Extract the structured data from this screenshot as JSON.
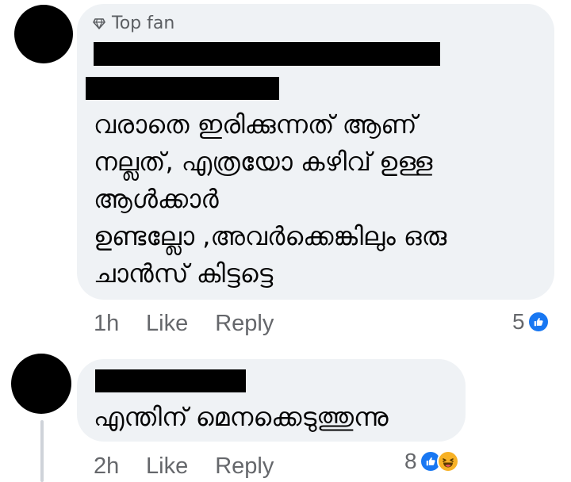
{
  "comments": [
    {
      "badge": "Top fan",
      "author": "",
      "text": "വരാതെ ഇരിക്കുന്നത് ആണ്\nനല്ലത്, എത്രയോ കഴിവ് ഉള്ള\nആൾക്കാർ\nഉണ്ടല്ലോ ,അവർക്കെങ്കിലും ഒരു\nചാൻസ് കിട്ടട്ടെ",
      "time": "1h",
      "like_label": "Like",
      "reply_label": "Reply",
      "reaction_count": "5",
      "reactions": [
        "like-icon"
      ]
    },
    {
      "author": "",
      "text": "എന്തിന് മെനക്കെടുത്തുന്നു",
      "time": "2h",
      "like_label": "Like",
      "reply_label": "Reply",
      "reaction_count": "8",
      "reactions": [
        "like-icon",
        "haha-icon"
      ]
    }
  ],
  "colors": {
    "bubble": "#eff2f5",
    "meta_text": "#65676b",
    "like_blue": "#1877f2",
    "haha_yellow": "#f7b125"
  }
}
